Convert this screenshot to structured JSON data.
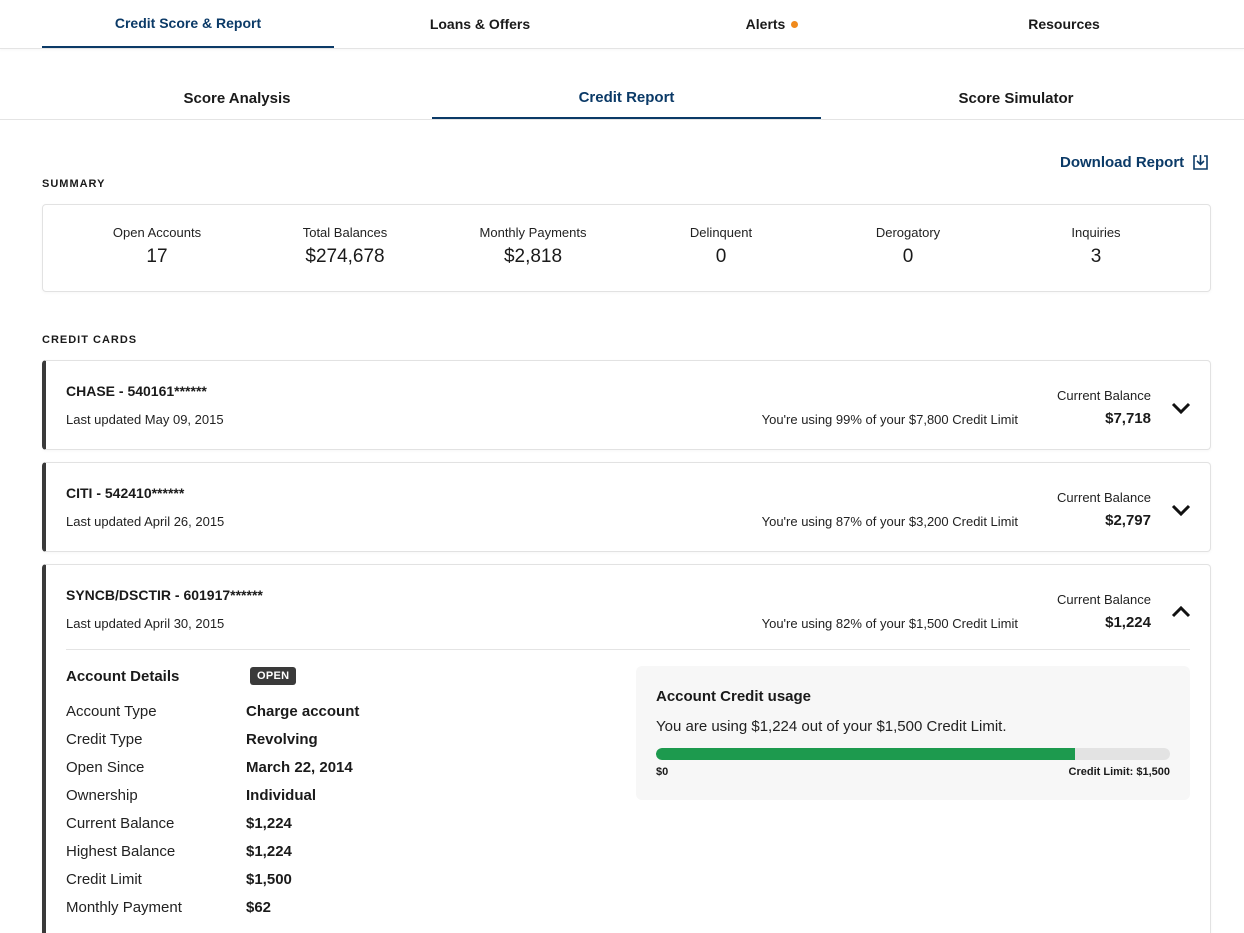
{
  "top_nav": {
    "tabs": [
      {
        "label": "Credit Score & Report",
        "active": true
      },
      {
        "label": "Loans & Offers",
        "active": false
      },
      {
        "label": "Alerts",
        "active": false,
        "has_dot": true
      },
      {
        "label": "Resources",
        "active": false
      }
    ]
  },
  "sub_nav": {
    "tabs": [
      {
        "label": "Score Analysis",
        "active": false
      },
      {
        "label": "Credit Report",
        "active": true
      },
      {
        "label": "Score Simulator",
        "active": false
      }
    ]
  },
  "download": {
    "label": "Download Report",
    "icon": "download-icon"
  },
  "summary": {
    "title": "SUMMARY",
    "stats": [
      {
        "label": "Open Accounts",
        "value": "17"
      },
      {
        "label": "Total Balances",
        "value": "$274,678"
      },
      {
        "label": "Monthly Payments",
        "value": "$2,818"
      },
      {
        "label": "Delinquent",
        "value": "0"
      },
      {
        "label": "Derogatory",
        "value": "0"
      },
      {
        "label": "Inquiries",
        "value": "3"
      }
    ]
  },
  "credit_cards": {
    "title": "CREDIT CARDS",
    "current_balance_label": "Current Balance",
    "items": [
      {
        "name": "CHASE - 540161******",
        "updated": "Last updated May 09, 2015",
        "usage": "You're using 99% of your $7,800 Credit Limit",
        "balance": "$7,718",
        "expanded": false
      },
      {
        "name": "CITI - 542410******",
        "updated": "Last updated April 26, 2015",
        "usage": "You're using 87% of your $3,200 Credit Limit",
        "balance": "$2,797",
        "expanded": false
      },
      {
        "name": "SYNCB/DSCTIR - 601917******",
        "updated": "Last updated April 30, 2015",
        "usage": "You're using 82% of your $1,500 Credit Limit",
        "balance": "$1,224",
        "expanded": true,
        "details": {
          "title": "Account Details",
          "status": "OPEN",
          "rows": [
            {
              "label": "Account Type",
              "value": "Charge account"
            },
            {
              "label": "Credit Type",
              "value": "Revolving"
            },
            {
              "label": "Open Since",
              "value": "March 22, 2014"
            },
            {
              "label": "Ownership",
              "value": "Individual"
            },
            {
              "label": "Current Balance",
              "value": "$1,224"
            },
            {
              "label": "Highest Balance",
              "value": "$1,224"
            },
            {
              "label": "Credit Limit",
              "value": "$1,500"
            },
            {
              "label": "Monthly Payment",
              "value": "$62"
            }
          ]
        },
        "credit_usage": {
          "title": "Account Credit usage",
          "description": "You are using $1,224 out of your $1,500 Credit Limit.",
          "fraction": 0.816,
          "min_label": "$0",
          "max_label": "Credit Limit: $1,500"
        }
      }
    ]
  },
  "colors": {
    "accent": "#0b3a67",
    "alert_dot": "#f08a1c",
    "progress": "#1d9a4e",
    "card_border": "#3a3a3a"
  }
}
